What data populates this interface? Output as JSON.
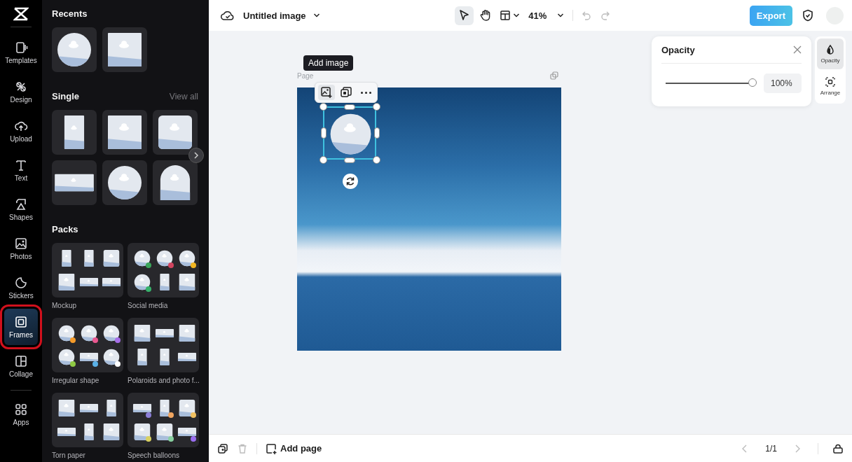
{
  "rail": {
    "items": [
      {
        "label": "Templates",
        "selected": false,
        "highlighted": false
      },
      {
        "label": "Design",
        "selected": false,
        "highlighted": false
      },
      {
        "label": "Upload",
        "selected": false,
        "highlighted": false
      },
      {
        "label": "Text",
        "selected": false,
        "highlighted": false
      },
      {
        "label": "Shapes",
        "selected": false,
        "highlighted": false
      },
      {
        "label": "Photos",
        "selected": false,
        "highlighted": false
      },
      {
        "label": "Stickers",
        "selected": false,
        "highlighted": false
      },
      {
        "label": "Frames",
        "selected": true,
        "highlighted": true
      },
      {
        "label": "Collage",
        "selected": false,
        "highlighted": false
      },
      {
        "label": "Apps",
        "selected": false,
        "highlighted": false
      }
    ]
  },
  "panel": {
    "recents": {
      "title": "Recents",
      "items": [
        {
          "kind": "circle"
        },
        {
          "kind": "square"
        }
      ]
    },
    "single": {
      "title": "Single",
      "link": "View all",
      "items": [
        {
          "kind": "tall"
        },
        {
          "kind": "square"
        },
        {
          "kind": "rounded"
        },
        {
          "kind": "wide"
        },
        {
          "kind": "circle"
        },
        {
          "kind": "arch"
        }
      ]
    },
    "packs": {
      "title": "Packs",
      "items": [
        {
          "label": "Mockup"
        },
        {
          "label": "Social media"
        },
        {
          "label": "Irregular shape"
        },
        {
          "label": "Polaroids and photo f..."
        },
        {
          "label": "Torn paper"
        },
        {
          "label": "Speech balloons"
        }
      ]
    }
  },
  "top_bar": {
    "title": "Untitled image",
    "tools": [
      {
        "kind": "pointer",
        "selected": true
      },
      {
        "kind": "hand",
        "selected": false
      }
    ],
    "zoom": "41%",
    "undo": {
      "disabled": true
    },
    "redo": {
      "disabled": true
    },
    "export": "Export"
  },
  "canvas": {
    "page_label": "Page",
    "tooltip": "Add image",
    "frame_toolbar": [
      {
        "kind": "add-image",
        "selected": true
      },
      {
        "kind": "duplicate",
        "selected": false
      },
      {
        "kind": "more",
        "selected": false
      }
    ]
  },
  "opacity_panel": {
    "title": "Opacity",
    "level": 1,
    "value": "100%"
  },
  "side_tabs": [
    {
      "label": "Opacity",
      "selected": true
    },
    {
      "label": "Arrange",
      "selected": false
    }
  ],
  "bottom_bar": {
    "delete": {
      "disabled": true
    },
    "add_page": "Add page",
    "prev": {
      "disabled": true
    },
    "page_count": "1/1",
    "next": {
      "disabled": true
    }
  }
}
